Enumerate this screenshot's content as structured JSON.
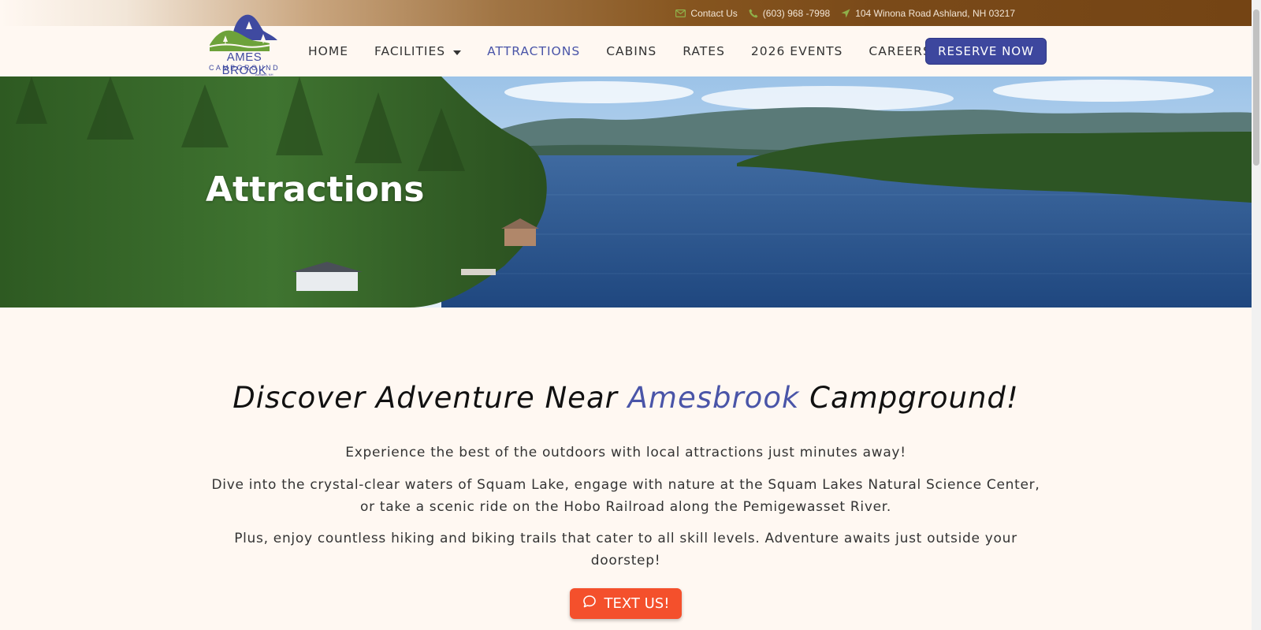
{
  "topbar": {
    "contact_label": "Contact Us",
    "phone": "(603) 968 -7998",
    "address": "104 Winona Road Ashland, NH 03217",
    "icons": [
      "mail-icon",
      "phone-icon",
      "location-arrow-icon"
    ]
  },
  "logo": {
    "line1": "AMES BROOK",
    "line2": "CAMPGROUND",
    "line3": "Ashland, NH"
  },
  "nav": {
    "items": [
      {
        "label": "HOME"
      },
      {
        "label": "FACILITIES"
      },
      {
        "label": "ATTRACTIONS"
      },
      {
        "label": "CABINS"
      },
      {
        "label": "RATES"
      },
      {
        "label": "2026 EVENTS"
      },
      {
        "label": "CAREERS"
      }
    ],
    "active": "ATTRACTIONS",
    "reserve_label": "RESERVE NOW"
  },
  "hero": {
    "title": "Attractions"
  },
  "content": {
    "heading_pre": "Discover Adventure Near ",
    "heading_accent": "Amesbrook",
    "heading_post": " Campground!",
    "p1": "Experience the best of the outdoors with local attractions just minutes away!",
    "p2": "Dive into the crystal-clear waters of Squam Lake, engage with nature at the Squam Lakes Natural Science Center, or take a scenic ride on the Hobo Railroad along the Pemigewasset River.",
    "p3": "Plus, enjoy countless hiking and biking trails that cater to all skill levels. Adventure awaits just outside your doorstep!"
  },
  "text_button": {
    "label": "TEXT US!",
    "icon": "chat-bubble-icon"
  },
  "colors": {
    "accent": "#4a55a8",
    "reserve_bg": "#3d479e",
    "text_us_bg": "#f4502c",
    "topbar_brown": "#744414",
    "page_bg": "#fff8f2"
  }
}
